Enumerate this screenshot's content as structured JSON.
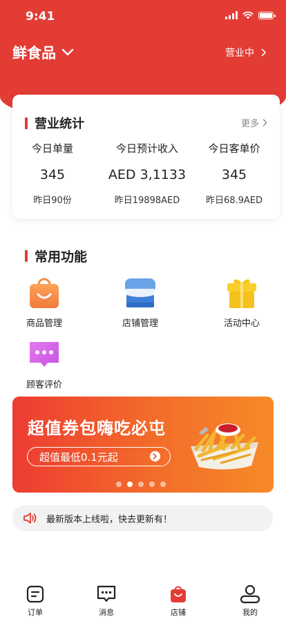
{
  "status_bar": {
    "time": "9:41"
  },
  "header": {
    "store_name": "鲜食品",
    "status_label": "营业中"
  },
  "stats": {
    "title": "营业统计",
    "more_label": "更多",
    "items": [
      {
        "label": "今日单量",
        "value": "345",
        "sub": "昨日90份"
      },
      {
        "label": "今日预计收入",
        "value": "AED 3,1133",
        "sub": "昨日19898AED"
      },
      {
        "label": "今日客单价",
        "value": "345",
        "sub": "昨日68.9AED"
      }
    ]
  },
  "functions": {
    "title": "常用功能",
    "items": [
      {
        "label": "商品管理",
        "icon": "shopping-bag-icon"
      },
      {
        "label": "店铺管理",
        "icon": "storefront-icon"
      },
      {
        "label": "活动中心",
        "icon": "gift-icon"
      },
      {
        "label": "顾客评价",
        "icon": "chat-bubble-icon"
      }
    ]
  },
  "banner": {
    "title": "超值券包嗨吃必屯",
    "button_label": "超值最低0.1元起",
    "slide_count": 5,
    "active_slide": 2
  },
  "notice": {
    "text": "最新版本上线啦，快去更新有！"
  },
  "tabbar": {
    "items": [
      {
        "label": "订单",
        "icon": "order-icon"
      },
      {
        "label": "消息",
        "icon": "message-icon"
      },
      {
        "label": "店铺",
        "icon": "shop-bag-icon",
        "active": true
      },
      {
        "label": "我的",
        "icon": "profile-icon"
      }
    ]
  },
  "colors": {
    "brand_red": "#e23c35",
    "banner_orange": "#f68a28"
  }
}
